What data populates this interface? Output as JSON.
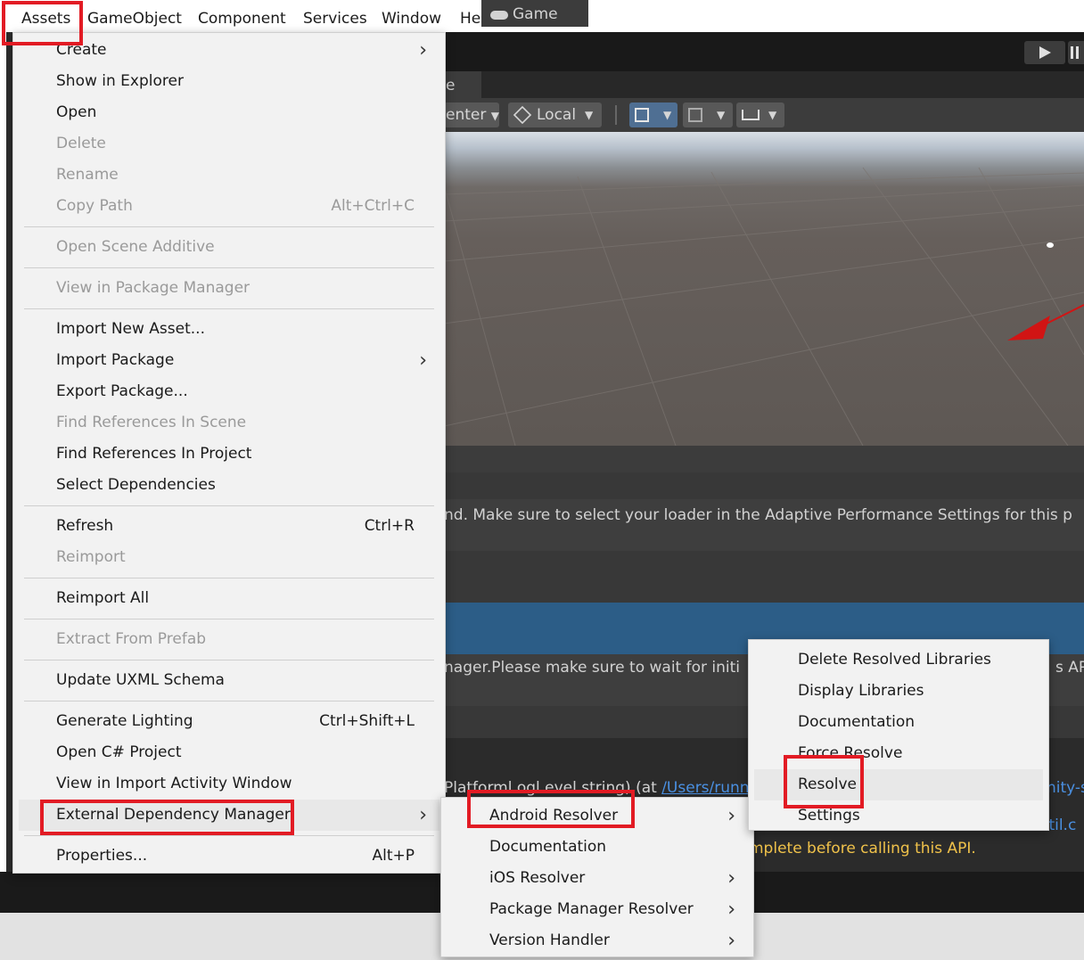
{
  "menubar": {
    "items": [
      "Assets",
      "GameObject",
      "Component",
      "Services",
      "Window",
      "Help"
    ]
  },
  "editor": {
    "tabs": {
      "scene_fragment": "e",
      "game": "Game"
    },
    "toolbar": {
      "pivot_fragment": "enter",
      "space": "Local"
    },
    "console": {
      "row2_text": "nd. Make sure to select your loader in the Adaptive Performance Settings for this p",
      "row5_text": "nager.Please make sure to wait for initi",
      "row5_tail": "s API",
      "detail_line1_prefix": "Platforml.ogl.evel.string) (at ",
      "detail_line1_link": "/Users/runn",
      "detail_line1_tail": "nity-s",
      "detail_line2": "mplete before calling this API.",
      "detail_line2_link": "Util.c"
    }
  },
  "assets_menu": {
    "groups": [
      [
        {
          "label": "Create",
          "submenu": true
        },
        {
          "label": "Show in Explorer"
        },
        {
          "label": "Open"
        },
        {
          "label": "Delete",
          "disabled": true
        },
        {
          "label": "Rename",
          "disabled": true
        },
        {
          "label": "Copy Path",
          "shortcut": "Alt+Ctrl+C",
          "disabled": true
        }
      ],
      [
        {
          "label": "Open Scene Additive",
          "disabled": true
        }
      ],
      [
        {
          "label": "View in Package Manager",
          "disabled": true
        }
      ],
      [
        {
          "label": "Import New Asset..."
        },
        {
          "label": "Import Package",
          "submenu": true
        },
        {
          "label": "Export Package..."
        },
        {
          "label": "Find References In Scene",
          "disabled": true
        },
        {
          "label": "Find References In Project"
        },
        {
          "label": "Select Dependencies"
        }
      ],
      [
        {
          "label": "Refresh",
          "shortcut": "Ctrl+R"
        },
        {
          "label": "Reimport",
          "disabled": true
        }
      ],
      [
        {
          "label": "Reimport All"
        }
      ],
      [
        {
          "label": "Extract From Prefab",
          "disabled": true
        }
      ],
      [
        {
          "label": "Update UXML Schema"
        }
      ],
      [
        {
          "label": "Generate Lighting",
          "shortcut": "Ctrl+Shift+L"
        },
        {
          "label": "Open C# Project"
        },
        {
          "label": "View in Import Activity Window"
        },
        {
          "label": "External Dependency Manager",
          "submenu": true,
          "highlighted": true
        }
      ],
      [
        {
          "label": "Properties...",
          "shortcut": "Alt+P"
        }
      ]
    ]
  },
  "edm_menu": {
    "items": [
      {
        "label": "Android Resolver",
        "submenu": true
      },
      {
        "label": "Documentation"
      },
      {
        "label": "iOS Resolver",
        "submenu": true
      },
      {
        "label": "Package Manager Resolver",
        "submenu": true
      },
      {
        "label": "Version Handler",
        "submenu": true
      }
    ]
  },
  "android_menu": {
    "items": [
      {
        "label": "Delete Resolved Libraries"
      },
      {
        "label": "Display Libraries"
      },
      {
        "label": "Documentation"
      },
      {
        "label": "Force Resolve"
      },
      {
        "label": "Resolve",
        "highlighted": true
      },
      {
        "label": "Settings"
      }
    ]
  },
  "colors": {
    "highlight_box": "#e21b24",
    "console_selected": "#2c5d87",
    "warning_text": "#f0c24a",
    "link": "#4a90e2"
  }
}
